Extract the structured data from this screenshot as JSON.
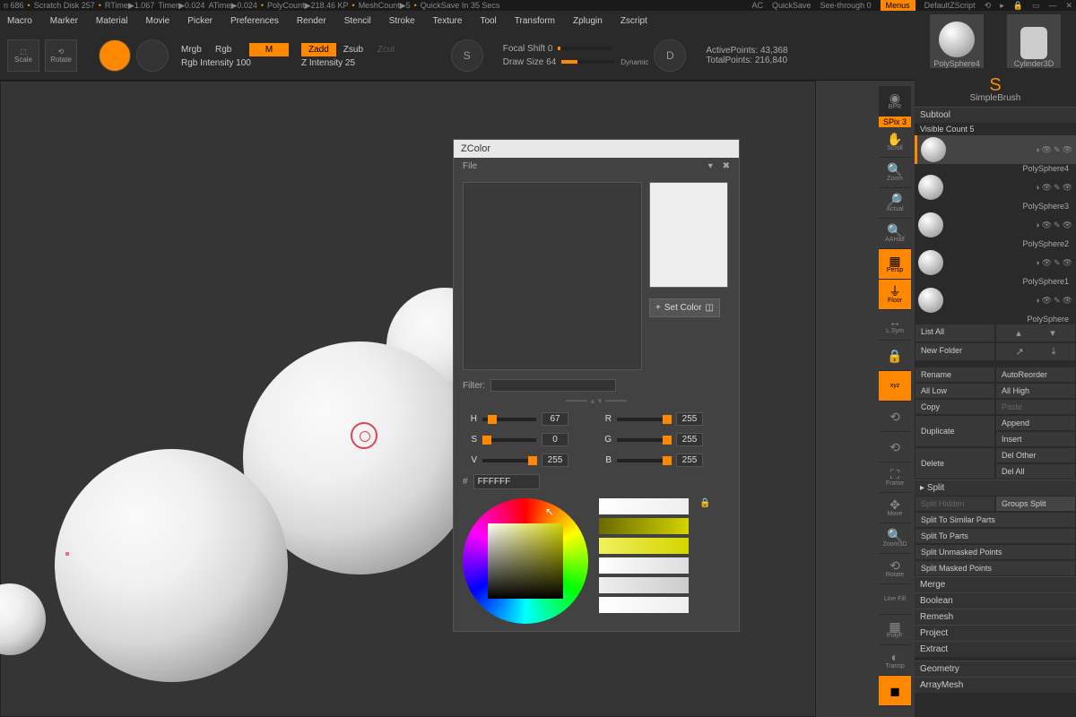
{
  "status": {
    "mem": "n 686",
    "scratch": "Scratch Disk 257",
    "rtime": "RTime▶1.067",
    "timer": "Timer▶0.024",
    "atime": "ATime▶0.024",
    "polycount": "PolyCount▶218.46 KP",
    "meshcount": "MeshCount▶5",
    "quicksave": "QuickSave In 35 Secs",
    "ac": "AC",
    "quicksave_btn": "QuickSave",
    "seethrough": "See-through  0",
    "menus": "Menus",
    "zscript": "DefaultZScript"
  },
  "menu": [
    "Macro",
    "Marker",
    "Material",
    "Movie",
    "Picker",
    "Preferences",
    "Render",
    "Stencil",
    "Stroke",
    "Texture",
    "Tool",
    "Transform",
    "Zplugin",
    "Zscript"
  ],
  "toolbar": {
    "scale": "Scale",
    "rotate": "Rotate",
    "mrgb": "Mrgb",
    "rgb": "Rgb",
    "m": "M",
    "rgb_intensity_label": "Rgb Intensity 100",
    "zadd": "Zadd",
    "zsub": "Zsub",
    "zcut": "Zcut",
    "z_intensity_label": "Z Intensity 25",
    "focal_shift": "Focal Shift 0",
    "draw_size": "Draw Size 64",
    "dynamic": "Dynamic",
    "active_points": "ActivePoints: 43,368",
    "total_points": "TotalPoints: 216,840"
  },
  "zcolor": {
    "title": "ZColor",
    "file": "File",
    "set_color": "Set Color",
    "filter": "Filter:",
    "hex": "FFFFFF",
    "H": "67",
    "S": "0",
    "V": "255",
    "R": "255",
    "G": "255",
    "B": "255",
    "h_label": "H",
    "s_label": "S",
    "v_label": "V",
    "r_label": "R",
    "g_label": "G",
    "b_label": "B",
    "hash": "#"
  },
  "right_tools": {
    "bpr": "BPR",
    "spix": "SPix 3",
    "scroll": "Scroll",
    "zoom": "Zoom",
    "actual": "Actual",
    "aahalf": "AAHalf",
    "persp": "Persp",
    "floor": "Floor",
    "lsym": "L.Sym",
    "xyz": "xyz",
    "frame": "Frame",
    "move": "Move",
    "zoom3d": "Zoom3D",
    "rotate": "Rotate",
    "linefill": "Line Fill",
    "polyf": "PolyF",
    "transp": "Transp",
    "dynamic": "Dynamic"
  },
  "panel": {
    "polysphere4": "PolySphere4",
    "cylinder3d": "Cylinder3D",
    "simplebrush": "SimpleBrush",
    "subtool": "Subtool",
    "visible_count": "Visible Count 5",
    "subitems": [
      "PolySphere4",
      "PolySphere3",
      "PolySphere2",
      "PolySphere1",
      "PolySphere"
    ],
    "list_all": "List All",
    "new_folder": "New Folder",
    "rename": "Rename",
    "autoreorder": "AutoReorder",
    "all_low": "All Low",
    "all_high": "All High",
    "copy": "Copy",
    "paste": "Paste",
    "duplicate": "Duplicate",
    "append": "Append",
    "insert": "Insert",
    "delete": "Delete",
    "del_other": "Del Other",
    "del_all": "Del All",
    "split": "Split",
    "split_hidden": "Split Hidden",
    "groups_split": "Groups Split",
    "split_similar": "Split To Similar Parts",
    "split_parts": "Split To Parts",
    "split_unmasked": "Split Unmasked Points",
    "split_masked": "Split Masked Points",
    "merge": "Merge",
    "boolean": "Boolean",
    "remesh": "Remesh",
    "project": "Project",
    "extract": "Extract",
    "geometry": "Geometry",
    "arraymesh": "ArrayMesh"
  }
}
